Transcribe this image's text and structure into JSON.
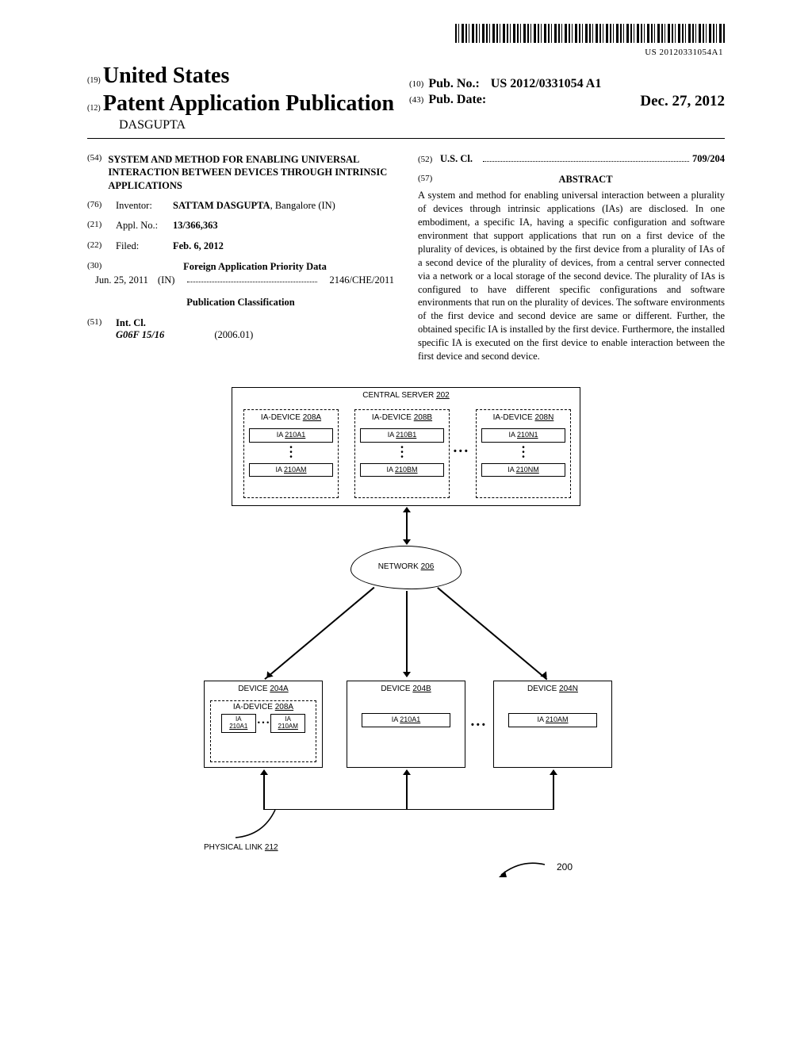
{
  "barcode_number": "US 20120331054A1",
  "header": {
    "country_code": "(19)",
    "country": "United States",
    "doctype_code": "(12)",
    "doctype": "Patent Application Publication",
    "author": "DASGUPTA",
    "pubno_code": "(10)",
    "pubno_label": "Pub. No.:",
    "pubno_value": "US 2012/0331054 A1",
    "pubdate_code": "(43)",
    "pubdate_label": "Pub. Date:",
    "pubdate_value": "Dec. 27, 2012"
  },
  "fields": {
    "f54_code": "(54)",
    "f54_title": "SYSTEM AND METHOD FOR ENABLING UNIVERSAL INTERACTION BETWEEN DEVICES THROUGH INTRINSIC APPLICATIONS",
    "f76_code": "(76)",
    "f76_label": "Inventor:",
    "f76_value": "SATTAM DASGUPTA",
    "f76_loc": ", Bangalore (IN)",
    "f21_code": "(21)",
    "f21_label": "Appl. No.:",
    "f21_value": "13/366,363",
    "f22_code": "(22)",
    "f22_label": "Filed:",
    "f22_value": "Feb. 6, 2012",
    "f30_code": "(30)",
    "f30_heading": "Foreign Application Priority Data",
    "priority_date": "Jun. 25, 2011",
    "priority_country": "(IN)",
    "priority_num": "2146/CHE/2011",
    "pubclass_heading": "Publication Classification",
    "f51_code": "(51)",
    "f51_label": "Int. Cl.",
    "f51_class": "G06F 15/16",
    "f51_year": "(2006.01)",
    "f52_code": "(52)",
    "f52_label": "U.S. Cl.",
    "f52_value": "709/204",
    "f57_code": "(57)",
    "f57_heading": "ABSTRACT",
    "abstract": "A system and method for enabling universal interaction between a plurality of devices through intrinsic applications (IAs) are disclosed. In one embodiment, a specific IA, having a specific configuration and software environment that support applications that run on a first device of the plurality of devices, is obtained by the first device from a plurality of IAs of a second device of the plurality of devices, from a central server connected via a network or a local storage of the second device. The plurality of IAs is configured to have different specific configurations and software environments that run on the plurality of devices. The software environments of the first device and second device are same or different. Further, the obtained specific IA is installed by the first device. Furthermore, the installed specific IA is executed on the first device to enable interaction between the first device and second device."
  },
  "diagram": {
    "server_label": "CENTRAL SERVER",
    "server_ref": "202",
    "ia_device_a": "IA-DEVICE",
    "ia_device_a_ref": "208A",
    "ia_device_b": "IA-DEVICE",
    "ia_device_b_ref": "208B",
    "ia_device_n": "IA-DEVICE",
    "ia_device_n_ref": "208N",
    "ia_a1": "IA",
    "ia_a1_ref": "210A1",
    "ia_am": "IA",
    "ia_am_ref": "210AM",
    "ia_b1": "IA",
    "ia_b1_ref": "210B1",
    "ia_bm": "IA",
    "ia_bm_ref": "210BM",
    "ia_n1": "IA",
    "ia_n1_ref": "210N1",
    "ia_nm": "IA",
    "ia_nm_ref": "210NM",
    "network": "NETWORK",
    "network_ref": "206",
    "device_a": "DEVICE",
    "device_a_ref": "204A",
    "device_b": "DEVICE",
    "device_b_ref": "204B",
    "device_n": "DEVICE",
    "device_n_ref": "204N",
    "phys_link": "PHYSICAL LINK",
    "phys_link_ref": "212",
    "fig_ref": "200"
  }
}
